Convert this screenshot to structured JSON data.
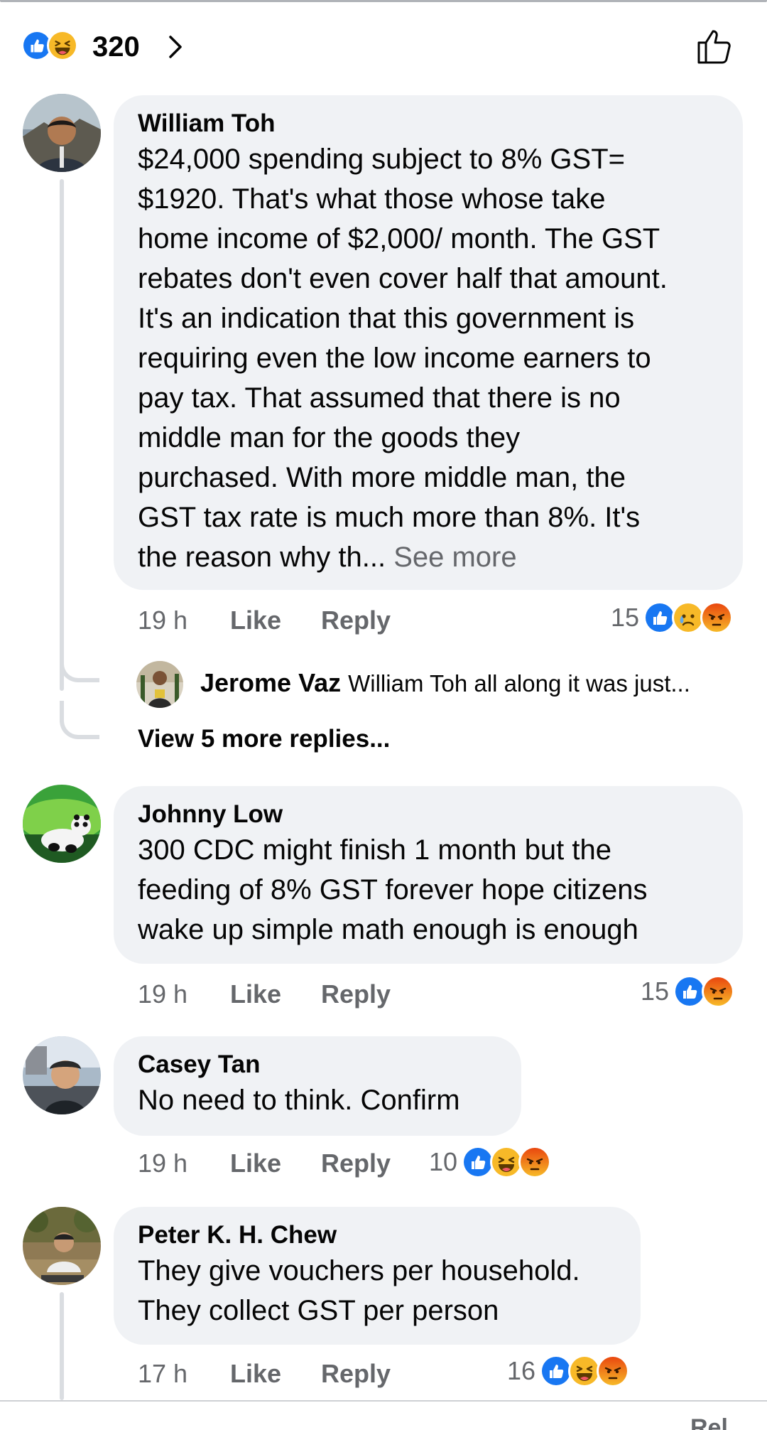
{
  "header": {
    "reaction_icons": [
      "like-reaction-icon",
      "haha-reaction-icon"
    ],
    "count": "320"
  },
  "comments": [
    {
      "author": "William Toh",
      "text": "$24,000 spending subject to 8% GST=\n$1920. That's what those whose take\nhome income of $2,000/ month. The GST\nrebates don't even cover half that amount.\nIt's an indication that this government is\nrequiring even the low income earners to\npay tax. That assumed that there is no\nmiddle man for the goods they\npurchased. With more middle man, the\nGST tax rate is much more than 8%. It's\nthe reason why th... ",
      "see_more": "See more",
      "time": "19 h",
      "like": "Like",
      "reply": "Reply",
      "reaction_count": "15",
      "reactions": [
        "like-reaction-icon",
        "sad-reaction-icon",
        "angry-reaction-icon"
      ],
      "reply_preview": {
        "author": "Jerome Vaz",
        "text": "William Toh all along it was just..."
      },
      "view_more": "View 5 more replies..."
    },
    {
      "author": "Johnny Low",
      "text": "300 CDC might finish 1 month but the\nfeeding of 8% GST forever hope citizens\nwake up simple math enough is enough",
      "time": "19 h",
      "like": "Like",
      "reply": "Reply",
      "reaction_count": "15",
      "reactions": [
        "like-reaction-icon",
        "angry-reaction-icon"
      ]
    },
    {
      "author": "Casey Tan",
      "text": "No need to think. Confirm",
      "time": "19 h",
      "like": "Like",
      "reply": "Reply",
      "reaction_count": "10",
      "reactions": [
        "like-reaction-icon",
        "haha-reaction-icon",
        "angry-reaction-icon"
      ]
    },
    {
      "author": "Peter K. H. Chew",
      "text": "They give vouchers per household.\nThey collect GST per person",
      "time": "17 h",
      "like": "Like",
      "reply": "Reply",
      "reaction_count": "16",
      "reactions": [
        "like-reaction-icon",
        "haha-reaction-icon",
        "angry-reaction-icon"
      ]
    }
  ],
  "bottom_bar": {
    "partial_text": "Rel"
  },
  "colors": {
    "like_blue": "#1877f2",
    "emoji_yellow": "#f7b928",
    "angry_orange": "#e9710f",
    "bubble_bg": "#f0f2f5",
    "secondary_text": "#65676b"
  }
}
